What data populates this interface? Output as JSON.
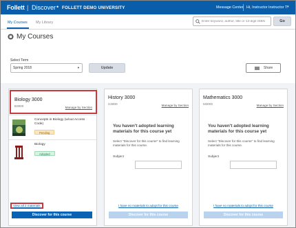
{
  "header": {
    "brand": "Follett",
    "product": "Discover",
    "separator": "|",
    "dot": "•",
    "school": "FOLLETT DEMO UNIVERSITY",
    "message_center": "Message Center",
    "user_greeting": "Hi, Instructor Instructor T.",
    "user_caret": "▾",
    "bar_color": "#0a5da8"
  },
  "tabs": [
    {
      "label": "My Courses",
      "active": true
    },
    {
      "label": "My Library",
      "active": false
    }
  ],
  "search": {
    "placeholder": "Enter keyword, author, title or 13-digit ISBN",
    "value": "",
    "go_label": "Go"
  },
  "page": {
    "title": "My Courses",
    "title_icon": "course-icon"
  },
  "term": {
    "label": "Select Term",
    "selected": "Spring 2018",
    "caret": "▾",
    "update_label": "Update",
    "share_label": "Share",
    "share_icon": "envelope-icon"
  },
  "courses": [
    {
      "name": "Biology 3000",
      "code": "B3000",
      "manage_link": "Manage by Section",
      "materials": [
        {
          "title": "Concepts in Biology (w/out Access Code)",
          "status": "Pending",
          "cover_icon": "book-cover-biology"
        },
        {
          "title": "Biology",
          "status": "Adopted",
          "cover_icon": "book-cover-column"
        }
      ],
      "view_all": "View all 2 materials",
      "discover_label": "Discover for this course"
    },
    {
      "name": "History 3000",
      "code": "H3000",
      "manage_link": "Manage by Section",
      "empty_title": "You haven't adopted learning materials for this course yet",
      "empty_text": "Select \"Discover for this course\" to find learning materials for this course.",
      "subject_label": "Subject",
      "no_materials_link": "I have no materials to adopt for this course",
      "discover_label": "Discover for this course"
    },
    {
      "name": "Mathematics 3000",
      "code": "M3000",
      "manage_link": "Manage by Section",
      "empty_title": "You haven't adopted learning materials for this course yet",
      "empty_text": "Select \"Discover for this course\" to find learning materials for this course.",
      "subject_label": "Subject",
      "no_materials_link": "I have no materials to adopt for this course",
      "discover_label": "Discover for this course"
    }
  ],
  "colors": {
    "primary": "#0a5da8",
    "highlight": "#c8383f",
    "pending": "#fbe6c2",
    "adopted": "#d8f1e3"
  }
}
